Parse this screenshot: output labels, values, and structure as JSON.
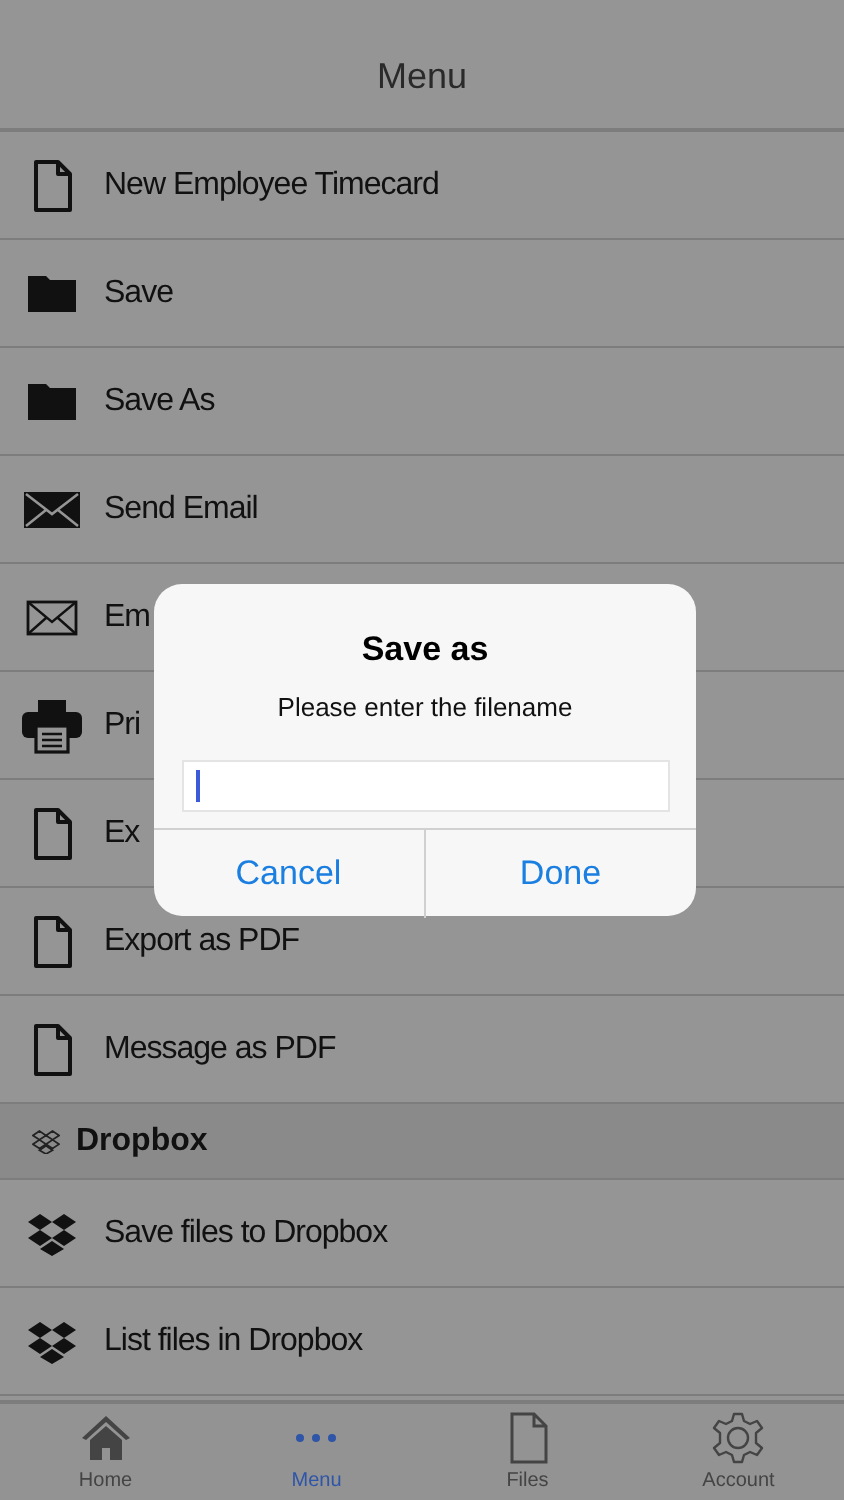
{
  "header": {
    "title": "Menu"
  },
  "menu_items": [
    {
      "kind": "document",
      "label": "New Employee Timecard"
    },
    {
      "kind": "folder",
      "label": "Save"
    },
    {
      "kind": "folder",
      "label": "Save As"
    },
    {
      "kind": "mail-filled",
      "label": "Send Email"
    },
    {
      "kind": "mail-outline",
      "label": "Em"
    },
    {
      "kind": "printer",
      "label": "Pri"
    },
    {
      "kind": "document",
      "label": "Ex"
    },
    {
      "kind": "document",
      "label": "Export as PDF"
    },
    {
      "kind": "document",
      "label": "Message as PDF"
    }
  ],
  "section": {
    "title": "Dropbox"
  },
  "dropbox_items": [
    {
      "kind": "dropbox",
      "label": "Save files to Dropbox"
    },
    {
      "kind": "dropbox",
      "label": "List files in Dropbox"
    }
  ],
  "tab_bar": [
    {
      "kind": "home",
      "label": "Home",
      "selected": false
    },
    {
      "kind": "dots",
      "label": "Menu",
      "selected": true
    },
    {
      "kind": "file",
      "label": "Files",
      "selected": false
    },
    {
      "kind": "gear",
      "label": "Account",
      "selected": false
    }
  ],
  "dialog": {
    "title": "Save as",
    "message": "Please enter the filename",
    "buttons": [
      "Cancel",
      "Done"
    ]
  }
}
